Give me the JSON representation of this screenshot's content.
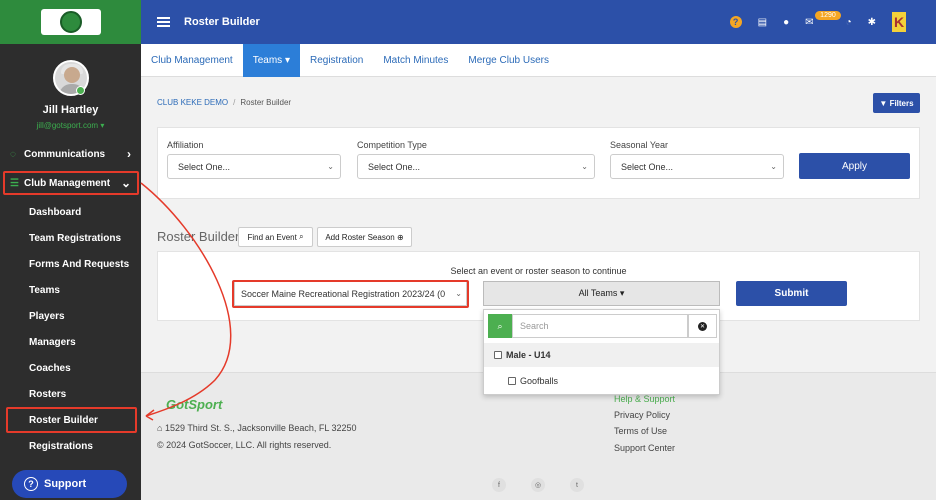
{
  "sidebar": {
    "logo_alt": "Soccer Maine",
    "profile": {
      "name": "Jill Hartley",
      "email": "jill@gotsport.com"
    },
    "top_items": [
      {
        "label": "Communications",
        "icon": "comments-icon",
        "chevron": "›"
      },
      {
        "label": "Club Management",
        "icon": "list-icon",
        "chevron": "⌄"
      }
    ],
    "sub_items": [
      "Dashboard",
      "Team Registrations",
      "Forms And Requests",
      "Teams",
      "Players",
      "Managers",
      "Coaches",
      "Rosters",
      "Roster Builder",
      "Registrations"
    ],
    "support_label": "Support"
  },
  "topbar": {
    "title": "Roster Builder",
    "notification_count": "1290",
    "brand_letter": "K"
  },
  "nav": {
    "tabs": [
      {
        "label": "Club Management"
      },
      {
        "label": "Teams ▾",
        "active": true
      },
      {
        "label": "Registration"
      },
      {
        "label": "Match Minutes"
      },
      {
        "label": "Merge Club Users"
      }
    ]
  },
  "breadcrumb": {
    "root": "CLUB KEKE DEMO",
    "current": "Roster Builder"
  },
  "filters_label": "Filters",
  "filter_form": {
    "affiliation_label": "Affiliation",
    "affiliation_value": "Select One...",
    "competition_label": "Competition Type",
    "competition_value": "Select One...",
    "seasonal_label": "Seasonal Year",
    "seasonal_value": "Select One...",
    "apply_label": "Apply"
  },
  "roster_builder": {
    "title": "Roster Builder",
    "find_event_label": "Find an Event",
    "add_season_label": "Add Roster Season",
    "hint": "Select an event or roster season to continue",
    "event_value": "Soccer Maine Recreational Registration 2023/24 (0",
    "all_teams_label": "All Teams ▾",
    "submit_label": "Submit",
    "dropdown": {
      "search_placeholder": "Search",
      "group": "Male - U14",
      "option": "Goofballs"
    }
  },
  "footer": {
    "logo": "GotSport",
    "address": "1529 Third St. S., Jacksonville Beach, FL 32250",
    "copyright": "© 2024 GotSoccer, LLC. All rights reserved.",
    "links": [
      "Help & Support",
      "Privacy Policy",
      "Terms of Use",
      "Support Center"
    ],
    "social": [
      "f",
      "◎",
      "t"
    ]
  },
  "colors": {
    "primary_blue": "#2c50a8",
    "accent_green": "#2e8b3d",
    "sidebar_bg": "#2d2d2d",
    "annotation_red": "#e53a2a"
  }
}
